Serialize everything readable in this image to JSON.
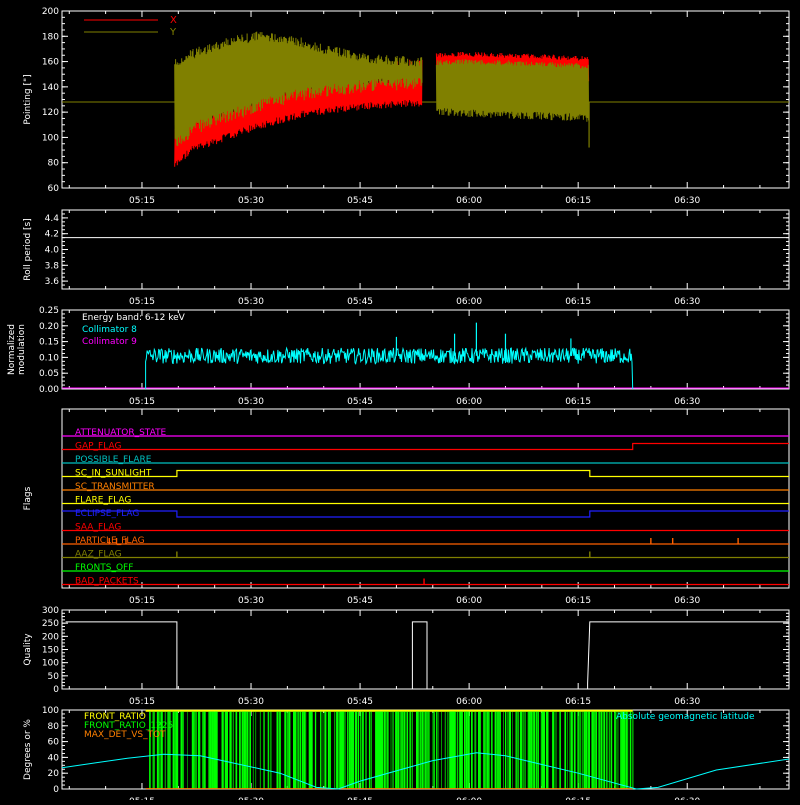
{
  "x_axis": {
    "start": "05:04",
    "end": "06:44",
    "tick_labels": [
      "05:15",
      "05:30",
      "05:45",
      "06:00",
      "06:15",
      "06:30"
    ],
    "tick_minutes": [
      315,
      330,
      345,
      360,
      375,
      390
    ]
  },
  "chart_data": [
    {
      "id": "pointing",
      "type": "line",
      "ylabel": "Pointing [\"]",
      "ylim": [
        60,
        200
      ],
      "yticks": [
        60,
        80,
        100,
        120,
        140,
        160,
        180,
        200
      ],
      "legend": [
        {
          "name": "X",
          "color": "#ff0000"
        },
        {
          "name": "Y",
          "color": "#808000"
        }
      ],
      "baseline": 128,
      "envelope_minutes": [
        319.5,
        322,
        325,
        328,
        331,
        334,
        337,
        340,
        343,
        346,
        349,
        352,
        353.5
      ],
      "x_low": [
        75,
        88,
        94,
        100,
        106,
        111,
        115,
        118,
        120,
        122,
        123,
        124,
        124
      ],
      "y_high": [
        163,
        170,
        176,
        181,
        184,
        183,
        179,
        174,
        170,
        167,
        165,
        164,
        164
      ],
      "envelope2_minutes": [
        355.5,
        360,
        365,
        370,
        374,
        376.5
      ],
      "x_high2": [
        167,
        168,
        167,
        166,
        165,
        164
      ],
      "y_low2": [
        118,
        116,
        115,
        114,
        113,
        112
      ]
    },
    {
      "id": "roll",
      "type": "line",
      "ylabel": "Roll period [s]",
      "ylim": [
        3.5,
        4.5
      ],
      "yticks": [
        3.6,
        3.8,
        4.0,
        4.2,
        4.4
      ],
      "ytick_labels": [
        "3.6",
        "3.8",
        "4.0",
        "4.2",
        "4.4"
      ],
      "value": 4.15
    },
    {
      "id": "modulation",
      "type": "line",
      "ylabel": "Normalized modulation",
      "ylim": [
        0,
        0.25
      ],
      "yticks": [
        0,
        0.05,
        0.1,
        0.15,
        0.2,
        0.25
      ],
      "ytick_labels": [
        "0.00",
        "0.05",
        "0.10",
        "0.15",
        "0.20",
        "0.25"
      ],
      "annotation": "Energy band: 6-12 keV",
      "legend": [
        {
          "name": "Collimator 8",
          "color": "#00ffff"
        },
        {
          "name": "Collimator 9",
          "color": "#ff00ff"
        }
      ],
      "active_range": [
        315.5,
        382.5
      ],
      "mean": 0.105,
      "spikes": [
        {
          "x": 361,
          "y": 0.21
        },
        {
          "x": 358,
          "y": 0.175
        },
        {
          "x": 365,
          "y": 0.175
        },
        {
          "x": 350,
          "y": 0.165
        },
        {
          "x": 374,
          "y": 0.16
        }
      ]
    },
    {
      "id": "flags",
      "type": "line",
      "ylabel": "Flags",
      "rows": [
        {
          "name": "ATTENUATOR_STATE",
          "color": "#ff00ff",
          "segments": [
            [
              0,
              0
            ]
          ]
        },
        {
          "name": "GAP_FLAG",
          "color": "#ff0000",
          "segments": [
            [
              0,
              0
            ],
            [
              382.5,
              1
            ]
          ]
        },
        {
          "name": "POSSIBLE_FLARE",
          "color": "#00c0c0",
          "segments": [
            [
              0,
              0
            ]
          ]
        },
        {
          "name": "SC_IN_SUNLIGHT",
          "color": "#ffff00",
          "segments": [
            [
              0,
              0
            ],
            [
              319.8,
              1
            ],
            [
              376.6,
              0
            ]
          ]
        },
        {
          "name": "SC_TRANSMITTER",
          "color": "#ff8000",
          "segments": [
            [
              0,
              0
            ]
          ]
        },
        {
          "name": "FLARE_FLAG",
          "color": "#ffff00",
          "segments": [
            [
              0,
              0
            ]
          ]
        },
        {
          "name": "ECLIPSE_FLAG",
          "color": "#2020ff",
          "segments": [
            [
              0,
              1
            ],
            [
              319.8,
              0
            ],
            [
              376.6,
              1
            ]
          ]
        },
        {
          "name": "SAA_FLAG",
          "color": "#ff0000",
          "segments": [
            [
              0,
              0
            ]
          ]
        },
        {
          "name": "PARTICLE_FLAG",
          "color": "#ff6000",
          "segments": [
            [
              0,
              0
            ]
          ],
          "ticks": [
            310.5,
            311.5,
            312.8,
            385,
            388,
            397
          ]
        },
        {
          "name": "AAZ_FLAG",
          "color": "#808000",
          "segments": [
            [
              0,
              0
            ]
          ],
          "ticks": [
            319.8,
            376.6
          ]
        },
        {
          "name": "FRONTS_OFF",
          "color": "#00ff00",
          "segments": [
            [
              0,
              0
            ]
          ]
        },
        {
          "name": "BAD_PACKETS",
          "color": "#ff0000",
          "segments": [
            [
              0,
              0
            ]
          ],
          "ticks": [
            353.8
          ]
        }
      ]
    },
    {
      "id": "quality",
      "type": "line",
      "ylabel": "Quality",
      "ylim": [
        0,
        300
      ],
      "yticks": [
        0,
        50,
        100,
        150,
        200,
        250,
        300
      ],
      "points": [
        [
          304.5,
          255
        ],
        [
          319.8,
          255
        ],
        [
          319.8,
          0
        ],
        [
          352.2,
          0
        ],
        [
          352.2,
          255
        ],
        [
          354.2,
          255
        ],
        [
          354.2,
          0
        ],
        [
          376.3,
          0
        ],
        [
          376.3,
          20
        ],
        [
          376.6,
          255
        ],
        [
          404,
          255
        ]
      ]
    },
    {
      "id": "latitude",
      "type": "area",
      "ylabel": "Degrees or %",
      "ylim": [
        0,
        100
      ],
      "yticks": [
        0,
        20,
        40,
        60,
        80,
        100
      ],
      "legend": [
        {
          "name": "FRONT_RATIO",
          "color": "#ffff00"
        },
        {
          "name": "FRONT_RATIO_1225",
          "color": "#00ff00"
        },
        {
          "name": "MAX_DET_VS_TOT",
          "color": "#ff8000"
        }
      ],
      "latitude_label": "Absolute geomagnetic latitude",
      "latitude_color": "#00ffff",
      "latitude_points": [
        [
          304,
          27
        ],
        [
          313,
          39
        ],
        [
          318,
          44
        ],
        [
          323,
          42
        ],
        [
          334,
          20
        ],
        [
          339,
          2
        ],
        [
          342,
          0
        ],
        [
          345,
          10
        ],
        [
          355,
          36
        ],
        [
          361,
          46
        ],
        [
          365,
          42
        ],
        [
          375,
          20
        ],
        [
          383,
          0
        ],
        [
          386,
          2
        ],
        [
          394,
          24
        ],
        [
          404,
          38
        ]
      ],
      "green_range": [
        315.5,
        382.5
      ]
    }
  ]
}
